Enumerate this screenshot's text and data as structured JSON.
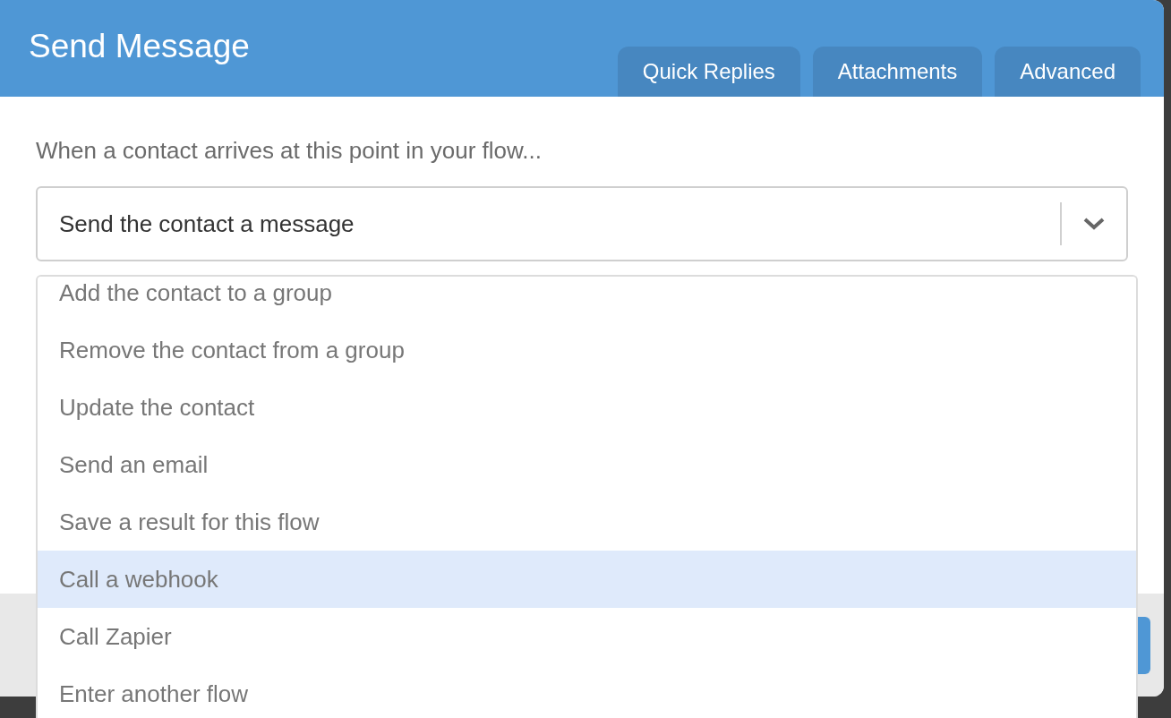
{
  "dialog": {
    "title": "Send Message"
  },
  "tabs": [
    {
      "label": "Quick Replies",
      "selected": false
    },
    {
      "label": "Attachments",
      "selected": false
    },
    {
      "label": "Advanced",
      "selected": false
    }
  ],
  "prompt": "When a contact arrives at this point in your flow...",
  "action_select": {
    "value": "Send the contact a message",
    "expanded": true
  },
  "options": [
    {
      "label": "Add the contact to a group",
      "selected": false
    },
    {
      "label": "Remove the contact from a group",
      "selected": false
    },
    {
      "label": "Update the contact",
      "selected": false
    },
    {
      "label": "Send an email",
      "selected": false
    },
    {
      "label": "Save a result for this flow",
      "selected": false
    },
    {
      "label": "Call a webhook",
      "selected": true
    },
    {
      "label": "Call Zapier",
      "selected": false
    },
    {
      "label": "Enter another flow",
      "selected": false
    }
  ]
}
